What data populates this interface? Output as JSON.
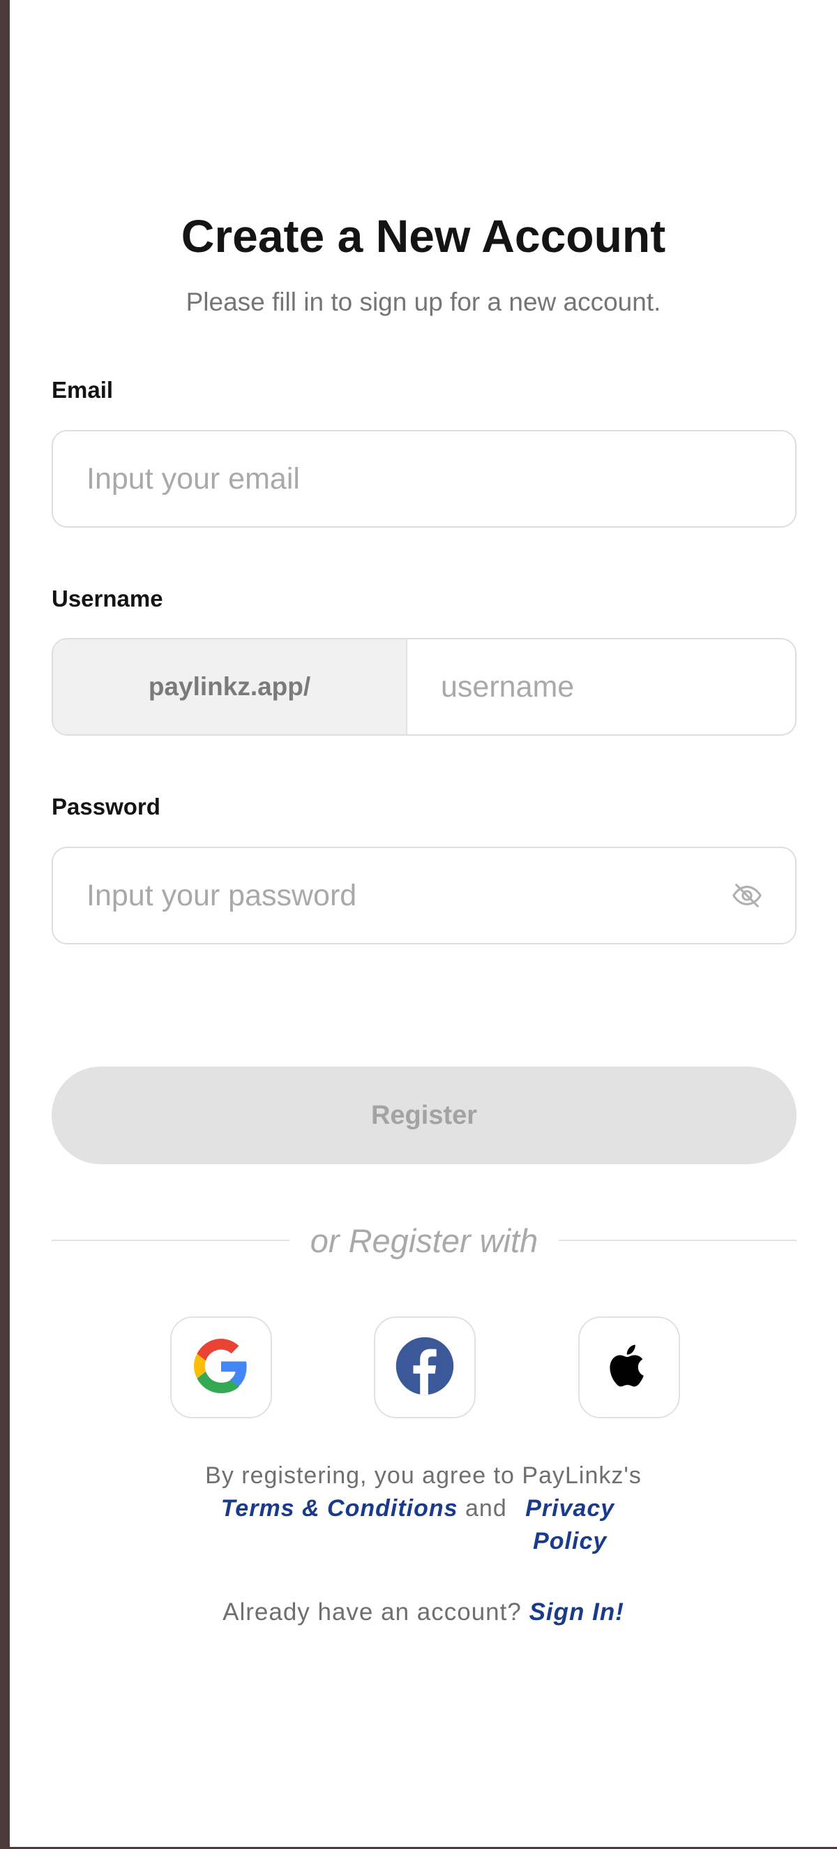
{
  "header": {
    "title": "Create a New Account",
    "subtitle": "Please fill in to sign up for a new account."
  },
  "email": {
    "label": "Email",
    "placeholder": "Input your email",
    "value": ""
  },
  "username": {
    "label": "Username",
    "prefix": "paylinkz.app/",
    "placeholder": "username",
    "value": ""
  },
  "password": {
    "label": "Password",
    "placeholder": "Input your password",
    "value": "",
    "toggle_icon": "eye-off-icon"
  },
  "register_button": {
    "label": "Register"
  },
  "divider": {
    "text": "or Register with"
  },
  "social": [
    {
      "provider": "Google",
      "icon": "google-icon"
    },
    {
      "provider": "Facebook",
      "icon": "facebook-icon"
    },
    {
      "provider": "Apple",
      "icon": "apple-icon"
    }
  ],
  "terms": {
    "prefix": "By registering, you agree to PayLinkz's",
    "terms_link": "Terms & Conditions",
    "and": "and",
    "privacy_link": "Privacy Policy"
  },
  "signin": {
    "prompt": "Already have an account?",
    "link": "Sign In!"
  },
  "colors": {
    "link": "#1a3a8c",
    "button_disabled_bg": "#e2e2e2",
    "facebook": "#3b5998"
  }
}
